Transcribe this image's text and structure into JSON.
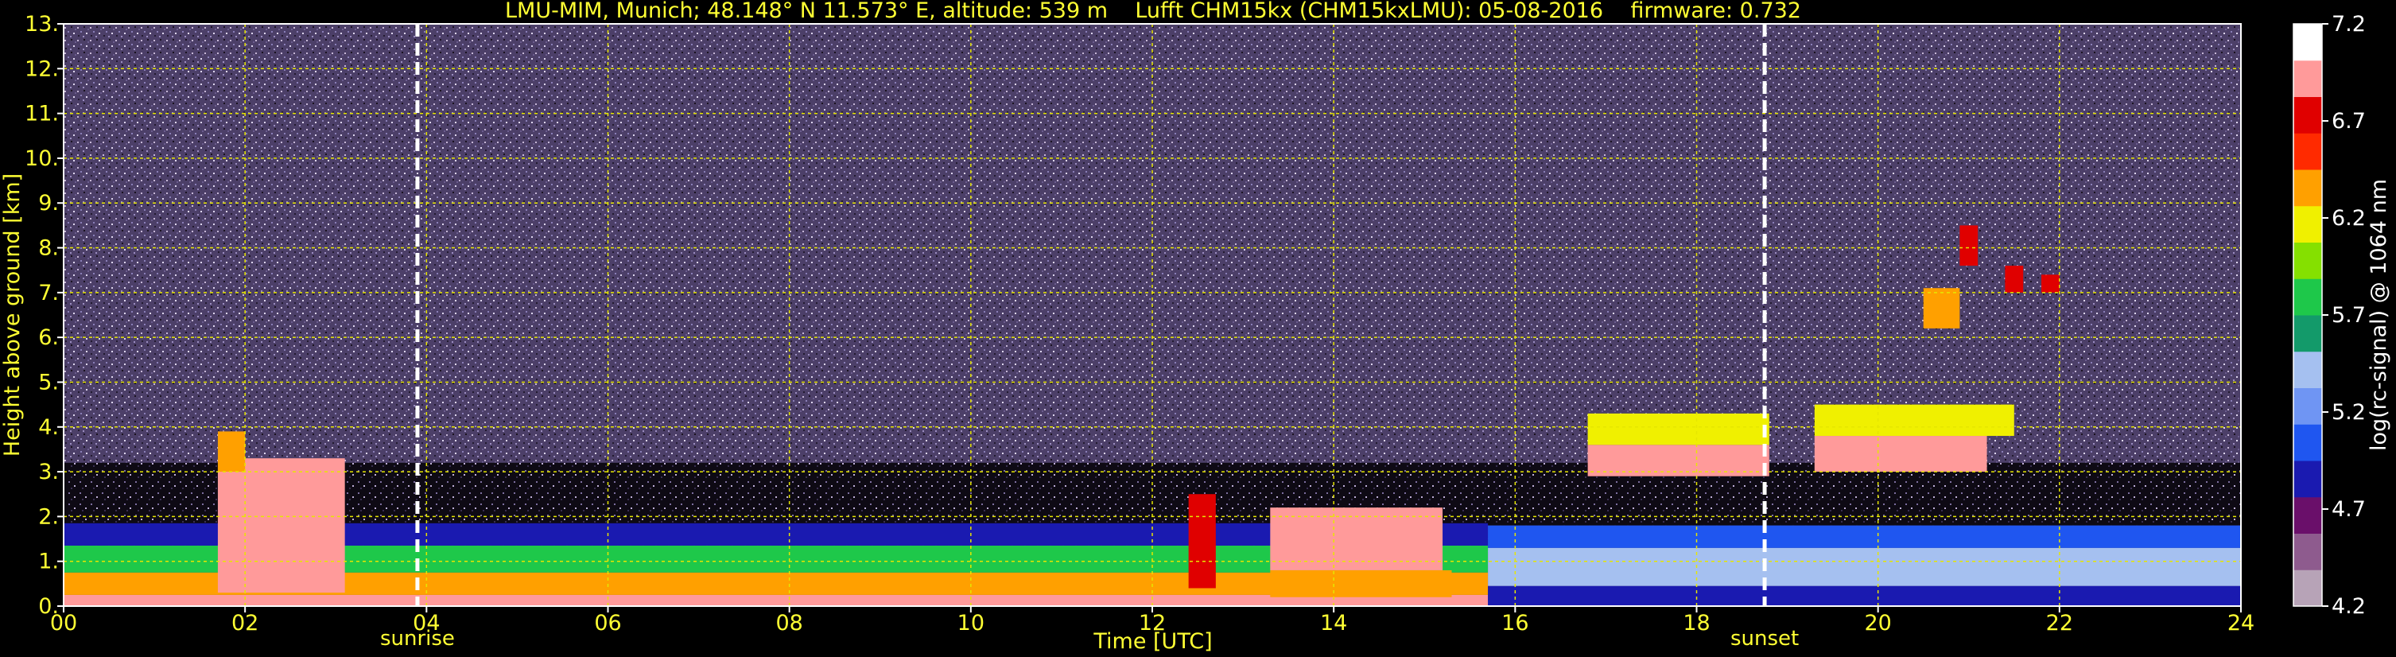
{
  "chart_data": {
    "type": "heatmap",
    "title": "LMU-MIM, Munich; 48.148° N 11.573° E, altitude: 539 m    Lufft CHM15kx (CHM15kxLMU): 05-08-2016    firmware: 0.732",
    "xlabel": "Time [UTC]",
    "ylabel": "Height above ground [km]",
    "xlim": [
      0,
      24
    ],
    "ylim": [
      0,
      13
    ],
    "x_ticks": [
      "00",
      "02",
      "04",
      "06",
      "08",
      "10",
      "12",
      "14",
      "16",
      "18",
      "20",
      "22",
      "24"
    ],
    "y_ticks": [
      "0.",
      "1.",
      "2.",
      "3.",
      "4.",
      "5.",
      "6.",
      "7.",
      "8.",
      "9.",
      "10.",
      "11.",
      "12.",
      "13."
    ],
    "grid": true,
    "markers": [
      {
        "label": "sunrise",
        "time": 3.9
      },
      {
        "label": "sunset",
        "time": 18.75
      }
    ],
    "colorbar": {
      "label": "log(rc-signal) @ 1064 nm",
      "range": [
        4.2,
        7.2
      ],
      "ticks": [
        "4.2",
        "4.7",
        "5.2",
        "5.7",
        "6.2",
        "6.7",
        "7.2"
      ],
      "colors": [
        "#b7a3b7",
        "#8e5b8e",
        "#6a0f6a",
        "#1a1ab0",
        "#1f56f0",
        "#6f95f3",
        "#a5c0f0",
        "#139a6a",
        "#1ec84a",
        "#85e000",
        "#f0f000",
        "#ffa000",
        "#ff2a00",
        "#e00000",
        "#ff9a9a",
        "#ffffff"
      ]
    },
    "layers": [
      {
        "t0": 0,
        "t1": 15.7,
        "h0": 0.0,
        "h1": 0.25,
        "value": 7.0
      },
      {
        "t0": 0,
        "t1": 15.7,
        "h0": 0.25,
        "h1": 0.75,
        "value": 6.3
      },
      {
        "t0": 0,
        "t1": 15.7,
        "h0": 0.75,
        "h1": 1.35,
        "value": 5.7
      },
      {
        "t0": 0,
        "t1": 15.7,
        "h0": 1.35,
        "h1": 1.85,
        "value": 4.9
      },
      {
        "t0": 1.7,
        "t1": 3.1,
        "h0": 0.3,
        "h1": 3.3,
        "value": 6.9
      },
      {
        "t0": 1.7,
        "t1": 2.0,
        "h0": 3.0,
        "h1": 3.9,
        "value": 6.3
      },
      {
        "t0": 12.4,
        "t1": 12.7,
        "h0": 0.4,
        "h1": 2.5,
        "value": 6.8
      },
      {
        "t0": 13.3,
        "t1": 15.2,
        "h0": 0.8,
        "h1": 2.2,
        "value": 6.9
      },
      {
        "t0": 13.3,
        "t1": 15.3,
        "h0": 0.2,
        "h1": 0.8,
        "value": 6.4
      },
      {
        "t0": 15.7,
        "t1": 24,
        "h0": 0.0,
        "h1": 0.45,
        "value": 4.9
      },
      {
        "t0": 15.7,
        "t1": 24,
        "h0": 0.45,
        "h1": 1.3,
        "value": 5.5
      },
      {
        "t0": 15.7,
        "t1": 24,
        "h0": 1.3,
        "h1": 1.8,
        "value": 5.0
      },
      {
        "t0": 16.8,
        "t1": 18.8,
        "h0": 2.9,
        "h1": 3.6,
        "value": 6.9
      },
      {
        "t0": 16.8,
        "t1": 18.8,
        "h0": 3.6,
        "h1": 4.3,
        "value": 6.2
      },
      {
        "t0": 19.3,
        "t1": 21.2,
        "h0": 3.0,
        "h1": 3.8,
        "value": 6.9
      },
      {
        "t0": 19.3,
        "t1": 21.5,
        "h0": 3.8,
        "h1": 4.5,
        "value": 6.2
      },
      {
        "t0": 20.5,
        "t1": 20.9,
        "h0": 6.2,
        "h1": 7.1,
        "value": 6.3
      },
      {
        "t0": 20.9,
        "t1": 21.1,
        "h0": 7.6,
        "h1": 8.5,
        "value": 6.7
      },
      {
        "t0": 21.4,
        "t1": 21.6,
        "h0": 7.0,
        "h1": 7.6,
        "value": 6.8
      },
      {
        "t0": 21.8,
        "t1": 22.0,
        "h0": 7.0,
        "h1": 7.4,
        "value": 6.7
      }
    ]
  }
}
